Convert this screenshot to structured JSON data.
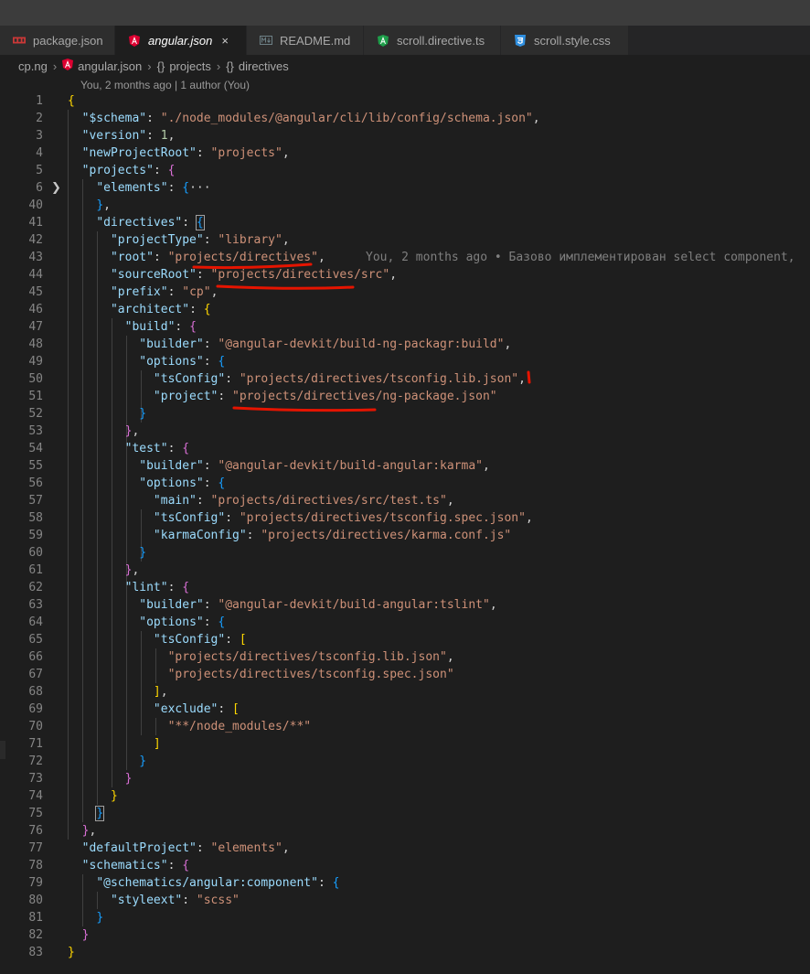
{
  "tabs": [
    {
      "label": "package.json",
      "icon": "npm-icon",
      "active": false,
      "italic": false
    },
    {
      "label": "angular.json",
      "icon": "angular-icon",
      "active": true,
      "italic": true
    },
    {
      "label": "README.md",
      "icon": "markdown-icon",
      "active": false,
      "italic": false
    },
    {
      "label": "scroll.directive.ts",
      "icon": "angular-directive-icon",
      "active": false,
      "italic": false
    },
    {
      "label": "scroll.style.css",
      "icon": "css-icon",
      "active": false,
      "italic": false
    }
  ],
  "tab_close_glyph": "×",
  "breadcrumbs": {
    "folder": "cp.ng",
    "file": "angular.json",
    "sym1_icon": "{}",
    "sym1": "projects",
    "sym2_icon": "{}",
    "sym2": "directives"
  },
  "codelens": "You, 2 months ago | 1 author (You)",
  "blame": "You, 2 months ago • Базово имплементирован select component,",
  "colors": {
    "key": "#9cdcfe",
    "string": "#ce9178",
    "number": "#b5cea8",
    "bracket1": "#ffd700",
    "bracket2": "#da70d6",
    "bracket3": "#179fff",
    "annotation": "#e51400"
  },
  "lines": [
    {
      "n": "1",
      "t": [
        [
          "b1",
          "{"
        ]
      ]
    },
    {
      "n": "2",
      "t": [
        [
          "p",
          "  "
        ],
        [
          "k",
          "\"$schema\""
        ],
        [
          "p",
          ": "
        ],
        [
          "s",
          "\"./node_modules/@angular/cli/lib/config/schema.json\""
        ],
        [
          "p",
          ","
        ]
      ]
    },
    {
      "n": "3",
      "t": [
        [
          "p",
          "  "
        ],
        [
          "k",
          "\"version\""
        ],
        [
          "p",
          ": "
        ],
        [
          "n",
          "1"
        ],
        [
          "p",
          ","
        ]
      ]
    },
    {
      "n": "4",
      "t": [
        [
          "p",
          "  "
        ],
        [
          "k",
          "\"newProjectRoot\""
        ],
        [
          "p",
          ": "
        ],
        [
          "s",
          "\"projects\""
        ],
        [
          "p",
          ","
        ]
      ]
    },
    {
      "n": "5",
      "t": [
        [
          "p",
          "  "
        ],
        [
          "k",
          "\"projects\""
        ],
        [
          "p",
          ": "
        ],
        [
          "b2",
          "{"
        ]
      ]
    },
    {
      "n": "6",
      "fold": true,
      "t": [
        [
          "p",
          "    "
        ],
        [
          "k",
          "\"elements\""
        ],
        [
          "p",
          ": "
        ],
        [
          "b3",
          "{"
        ],
        [
          "fold-dots",
          "···"
        ]
      ]
    },
    {
      "n": "40",
      "t": [
        [
          "p",
          "    "
        ],
        [
          "b3",
          "}"
        ],
        [
          "p",
          ","
        ]
      ]
    },
    {
      "n": "41",
      "t": [
        [
          "p",
          "    "
        ],
        [
          "k",
          "\"directives\""
        ],
        [
          "p",
          ": "
        ],
        [
          "b3 bbox",
          "{"
        ]
      ]
    },
    {
      "n": "42",
      "t": [
        [
          "p",
          "      "
        ],
        [
          "k",
          "\"projectType\""
        ],
        [
          "p",
          ": "
        ],
        [
          "s",
          "\"library\""
        ],
        [
          "p",
          ","
        ]
      ]
    },
    {
      "n": "43",
      "blame": true,
      "t": [
        [
          "p",
          "      "
        ],
        [
          "k",
          "\"root\""
        ],
        [
          "p",
          ": "
        ],
        [
          "s",
          "\"projects/directives\""
        ],
        [
          "p",
          ","
        ]
      ]
    },
    {
      "n": "44",
      "t": [
        [
          "p",
          "      "
        ],
        [
          "k",
          "\"sourceRoot\""
        ],
        [
          "p",
          ": "
        ],
        [
          "s",
          "\"projects/directives/src\""
        ],
        [
          "p",
          ","
        ]
      ]
    },
    {
      "n": "45",
      "t": [
        [
          "p",
          "      "
        ],
        [
          "k",
          "\"prefix\""
        ],
        [
          "p",
          ": "
        ],
        [
          "s",
          "\"cp\""
        ],
        [
          "p",
          ","
        ]
      ]
    },
    {
      "n": "46",
      "t": [
        [
          "p",
          "      "
        ],
        [
          "k",
          "\"architect\""
        ],
        [
          "p",
          ": "
        ],
        [
          "b1",
          "{"
        ]
      ]
    },
    {
      "n": "47",
      "t": [
        [
          "p",
          "        "
        ],
        [
          "k",
          "\"build\""
        ],
        [
          "p",
          ": "
        ],
        [
          "b2",
          "{"
        ]
      ]
    },
    {
      "n": "48",
      "t": [
        [
          "p",
          "          "
        ],
        [
          "k",
          "\"builder\""
        ],
        [
          "p",
          ": "
        ],
        [
          "s",
          "\"@angular-devkit/build-ng-packagr:build\""
        ],
        [
          "p",
          ","
        ]
      ]
    },
    {
      "n": "49",
      "t": [
        [
          "p",
          "          "
        ],
        [
          "k",
          "\"options\""
        ],
        [
          "p",
          ": "
        ],
        [
          "b3",
          "{"
        ]
      ]
    },
    {
      "n": "50",
      "t": [
        [
          "p",
          "            "
        ],
        [
          "k",
          "\"tsConfig\""
        ],
        [
          "p",
          ": "
        ],
        [
          "s",
          "\"projects/directives/tsconfig.lib.json\""
        ],
        [
          "p",
          ","
        ]
      ]
    },
    {
      "n": "51",
      "t": [
        [
          "p",
          "            "
        ],
        [
          "k",
          "\"project\""
        ],
        [
          "p",
          ": "
        ],
        [
          "s",
          "\"projects/directives/ng-package.json\""
        ]
      ]
    },
    {
      "n": "52",
      "t": [
        [
          "p",
          "          "
        ],
        [
          "b3",
          "}"
        ]
      ]
    },
    {
      "n": "53",
      "t": [
        [
          "p",
          "        "
        ],
        [
          "b2",
          "}"
        ],
        [
          "p",
          ","
        ]
      ]
    },
    {
      "n": "54",
      "t": [
        [
          "p",
          "        "
        ],
        [
          "k",
          "\"test\""
        ],
        [
          "p",
          ": "
        ],
        [
          "b2",
          "{"
        ]
      ]
    },
    {
      "n": "55",
      "t": [
        [
          "p",
          "          "
        ],
        [
          "k",
          "\"builder\""
        ],
        [
          "p",
          ": "
        ],
        [
          "s",
          "\"@angular-devkit/build-angular:karma\""
        ],
        [
          "p",
          ","
        ]
      ]
    },
    {
      "n": "56",
      "t": [
        [
          "p",
          "          "
        ],
        [
          "k",
          "\"options\""
        ],
        [
          "p",
          ": "
        ],
        [
          "b3",
          "{"
        ]
      ]
    },
    {
      "n": "57",
      "t": [
        [
          "p",
          "            "
        ],
        [
          "k",
          "\"main\""
        ],
        [
          "p",
          ": "
        ],
        [
          "s",
          "\"projects/directives/src/test.ts\""
        ],
        [
          "p",
          ","
        ]
      ]
    },
    {
      "n": "58",
      "t": [
        [
          "p",
          "            "
        ],
        [
          "k",
          "\"tsConfig\""
        ],
        [
          "p",
          ": "
        ],
        [
          "s",
          "\"projects/directives/tsconfig.spec.json\""
        ],
        [
          "p",
          ","
        ]
      ]
    },
    {
      "n": "59",
      "t": [
        [
          "p",
          "            "
        ],
        [
          "k",
          "\"karmaConfig\""
        ],
        [
          "p",
          ": "
        ],
        [
          "s",
          "\"projects/directives/karma.conf.js\""
        ]
      ]
    },
    {
      "n": "60",
      "t": [
        [
          "p",
          "          "
        ],
        [
          "b3",
          "}"
        ]
      ]
    },
    {
      "n": "61",
      "t": [
        [
          "p",
          "        "
        ],
        [
          "b2",
          "}"
        ],
        [
          "p",
          ","
        ]
      ]
    },
    {
      "n": "62",
      "t": [
        [
          "p",
          "        "
        ],
        [
          "k",
          "\"lint\""
        ],
        [
          "p",
          ": "
        ],
        [
          "b2",
          "{"
        ]
      ]
    },
    {
      "n": "63",
      "t": [
        [
          "p",
          "          "
        ],
        [
          "k",
          "\"builder\""
        ],
        [
          "p",
          ": "
        ],
        [
          "s",
          "\"@angular-devkit/build-angular:tslint\""
        ],
        [
          "p",
          ","
        ]
      ]
    },
    {
      "n": "64",
      "t": [
        [
          "p",
          "          "
        ],
        [
          "k",
          "\"options\""
        ],
        [
          "p",
          ": "
        ],
        [
          "b3",
          "{"
        ]
      ]
    },
    {
      "n": "65",
      "t": [
        [
          "p",
          "            "
        ],
        [
          "k",
          "\"tsConfig\""
        ],
        [
          "p",
          ": "
        ],
        [
          "b1",
          "["
        ]
      ]
    },
    {
      "n": "66",
      "t": [
        [
          "p",
          "              "
        ],
        [
          "s",
          "\"projects/directives/tsconfig.lib.json\""
        ],
        [
          "p",
          ","
        ]
      ]
    },
    {
      "n": "67",
      "t": [
        [
          "p",
          "              "
        ],
        [
          "s",
          "\"projects/directives/tsconfig.spec.json\""
        ]
      ]
    },
    {
      "n": "68",
      "t": [
        [
          "p",
          "            "
        ],
        [
          "b1",
          "]"
        ],
        [
          "p",
          ","
        ]
      ]
    },
    {
      "n": "69",
      "t": [
        [
          "p",
          "            "
        ],
        [
          "k",
          "\"exclude\""
        ],
        [
          "p",
          ": "
        ],
        [
          "b1",
          "["
        ]
      ]
    },
    {
      "n": "70",
      "t": [
        [
          "p",
          "              "
        ],
        [
          "s",
          "\"**/node_modules/**\""
        ]
      ]
    },
    {
      "n": "71",
      "t": [
        [
          "p",
          "            "
        ],
        [
          "b1",
          "]"
        ]
      ]
    },
    {
      "n": "72",
      "t": [
        [
          "p",
          "          "
        ],
        [
          "b3",
          "}"
        ]
      ]
    },
    {
      "n": "73",
      "t": [
        [
          "p",
          "        "
        ],
        [
          "b2",
          "}"
        ]
      ]
    },
    {
      "n": "74",
      "t": [
        [
          "p",
          "      "
        ],
        [
          "b1",
          "}"
        ]
      ]
    },
    {
      "n": "75",
      "t": [
        [
          "p",
          "    "
        ],
        [
          "b3 bbox",
          "}"
        ]
      ]
    },
    {
      "n": "76",
      "t": [
        [
          "p",
          "  "
        ],
        [
          "b2",
          "}"
        ],
        [
          "p",
          ","
        ]
      ]
    },
    {
      "n": "77",
      "t": [
        [
          "p",
          "  "
        ],
        [
          "k",
          "\"defaultProject\""
        ],
        [
          "p",
          ": "
        ],
        [
          "s",
          "\"elements\""
        ],
        [
          "p",
          ","
        ]
      ]
    },
    {
      "n": "78",
      "t": [
        [
          "p",
          "  "
        ],
        [
          "k",
          "\"schematics\""
        ],
        [
          "p",
          ": "
        ],
        [
          "b2",
          "{"
        ]
      ]
    },
    {
      "n": "79",
      "t": [
        [
          "p",
          "    "
        ],
        [
          "k",
          "\"@schematics/angular:component\""
        ],
        [
          "p",
          ": "
        ],
        [
          "b3",
          "{"
        ]
      ]
    },
    {
      "n": "80",
      "t": [
        [
          "p",
          "      "
        ],
        [
          "k",
          "\"styleext\""
        ],
        [
          "p",
          ": "
        ],
        [
          "s",
          "\"scss\""
        ]
      ]
    },
    {
      "n": "81",
      "t": [
        [
          "p",
          "    "
        ],
        [
          "b3",
          "}"
        ]
      ]
    },
    {
      "n": "82",
      "t": [
        [
          "p",
          "  "
        ],
        [
          "b2",
          "}"
        ]
      ]
    },
    {
      "n": "83",
      "t": [
        [
          "b1",
          "}"
        ]
      ]
    }
  ]
}
